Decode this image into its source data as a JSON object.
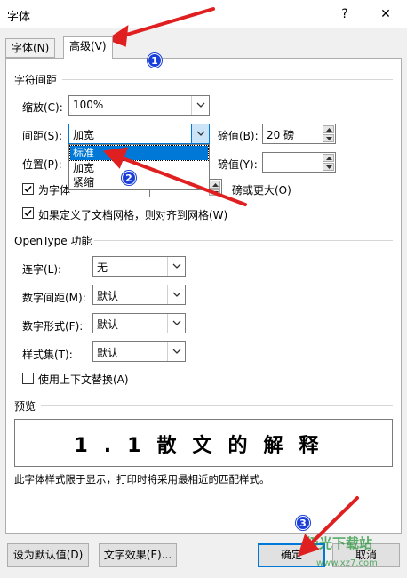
{
  "window": {
    "title": "字体",
    "help": "?",
    "close": "✕"
  },
  "tabs": [
    {
      "label": "字体(N)"
    },
    {
      "label": "高级(V)"
    }
  ],
  "char_spacing": {
    "title": "字符间距",
    "scale_label": "缩放(C):",
    "scale_value": "100%",
    "spacing_label": "间距(S):",
    "spacing_value": "加宽",
    "spacing_pt_label": "磅值(B):",
    "spacing_pt_value": "20 磅",
    "position_label": "位置(P):",
    "position_pt_label": "磅值(Y):",
    "position_pt_value": "",
    "kerning_label": "为字体",
    "kerning_suffix": "磅或更大(O)",
    "grid_label": "如果定义了文档网格，则对齐到网格(W)"
  },
  "spacing_options": [
    "标准",
    "加宽",
    "紧缩"
  ],
  "opentype": {
    "title": "OpenType 功能",
    "ligatures_label": "连字(L):",
    "ligatures_value": "无",
    "num_spacing_label": "数字间距(M):",
    "num_spacing_value": "默认",
    "num_form_label": "数字形式(F):",
    "num_form_value": "默认",
    "style_set_label": "样式集(T):",
    "style_set_value": "默认",
    "contextual_label": "使用上下文替换(A)"
  },
  "preview": {
    "title": "预览",
    "text": "1.1散文的解释",
    "note": "此字体样式限于显示，打印时将采用最相近的匹配样式。"
  },
  "footer": {
    "set_default": "设为默认值(D)",
    "text_effects": "文字效果(E)...",
    "ok": "确定",
    "cancel": "取消"
  },
  "annotations": [
    "1",
    "2",
    "3"
  ],
  "watermark": {
    "brand": "极光下载站",
    "url": "www.xz7.com"
  },
  "colors": {
    "accent": "#0078d7",
    "arrow": "#e02020",
    "badge": "#1a3fd8"
  }
}
